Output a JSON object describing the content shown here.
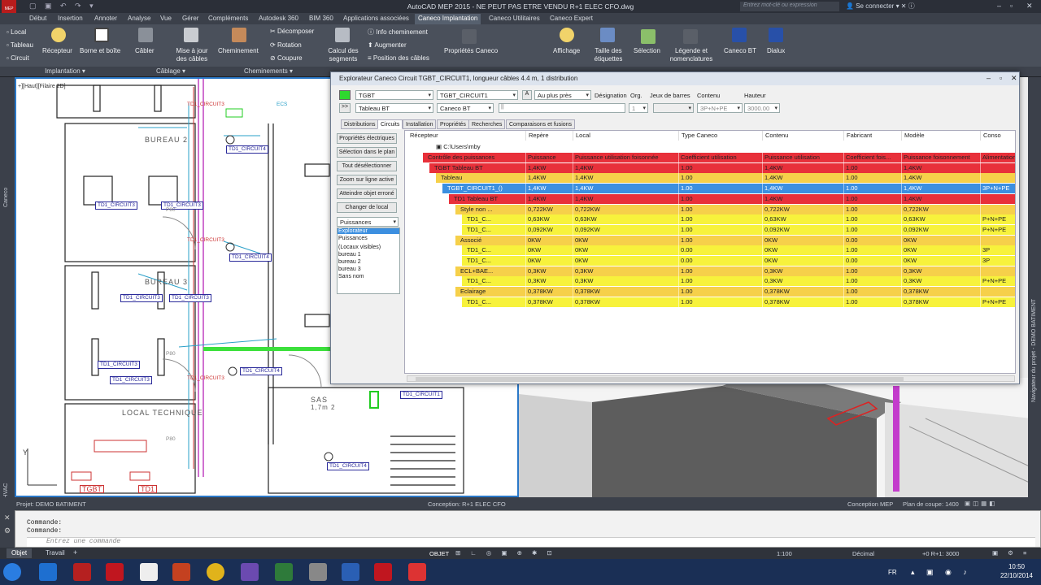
{
  "window": {
    "title": "AutoCAD MEP 2015 - NE PEUT PAS ETRE VENDU    R+1 ELEC CFO.dwg",
    "search_placeholder": "Entrez mot-clé ou expression",
    "signin": "Se connecter",
    "app_badge": "MEP"
  },
  "tabs": [
    "Début",
    "Insertion",
    "Annoter",
    "Analyse",
    "Vue",
    "Gérer",
    "Compléments",
    "Autodesk 360",
    "BIM 360",
    "Applications associées",
    "Caneco Implantation",
    "Caneco Utilitaires",
    "Caneco Expert"
  ],
  "ribbon": {
    "small": [
      "Local",
      "Tableau",
      "Circuit"
    ],
    "buttons": [
      "Récepteur",
      "Borne et boîte",
      "Câbler",
      "Mise à jour des câbles",
      "Cheminement",
      "Décomposer",
      "Rotation",
      "Coupure",
      "Calcul des segments",
      "Info cheminement",
      "Augmenter",
      "Position des câbles",
      "Propriétés Caneco",
      "Affichage",
      "Taille des étiquettes",
      "Sélection",
      "Légende et nomenclatures",
      "Caneco BT",
      "Dialux"
    ],
    "panels": [
      "Implantation",
      "Câblage",
      "Cheminements"
    ]
  },
  "drawing": {
    "viewport_label": "+][Haut][Filaire 2D]",
    "rooms": [
      "BUREAU 2",
      "BUREAU 3",
      "LOCAL TECHNIQUE",
      "SAS",
      "1,7m 2"
    ],
    "tags": [
      "TD1_CIRCUIT4",
      "TD1_CIRCUIT3",
      "TD1_CIRCUIT1",
      "TGBT",
      "TD1",
      "P80",
      "ECS"
    ],
    "axis": "Y",
    "side_left": "Palette d'outils - HVAC",
    "side_left2": "Caneco",
    "side_right": "Navigateur du projet - DEMO BATIMENT"
  },
  "dialog": {
    "title": "Explorateur Caneco  Circuit TGBT_CIRCUIT1, longueur câbles 4.4 m, 1 distribution",
    "row1": {
      "dd1": "TGBT",
      "dd2": "TGBT_CIRCUIT1",
      "a": "A",
      "dd3": "Au plus près",
      "designation": "Désignation",
      "org": "Org.",
      "jeux": "Jeux de barres",
      "contenu": "Contenu",
      "hauteur": "Hauteur"
    },
    "row2": {
      "nav": ">>",
      "dd1": "Tableau BT",
      "dd2": "Caneco BT",
      "field": "||",
      "org_val": "1",
      "contenu_val": "3P+N+PE",
      "hauteur_val": "3000.00"
    },
    "tabs": [
      "Distributions",
      "Circuits",
      "Installation",
      "Propriétés",
      "Recherches",
      "Comparaisons et fusions"
    ],
    "buttons": [
      "Propriétés électriques",
      "Sélection dans le plan",
      "Tout désélectionner",
      "Zoom sur ligne active",
      "Atteindre objet erroné",
      "Changer de local"
    ],
    "combo": "Puissances",
    "list": [
      "Explorateur",
      "Puissances",
      "(Locaux visibles)",
      "bureau 1",
      "bureau 2",
      "bureau 3",
      "Sans nom"
    ],
    "grid": {
      "columns": [
        "Récepteur",
        "Repère",
        "Local",
        "Type Caneco",
        "Contenu",
        "Fabricant",
        "Modèle",
        "Conso"
      ],
      "path": "C:\\Users\\mby",
      "rows": [
        {
          "label": "Contrôle des puissances",
          "c": [
            "Puissance",
            "Puissance utilisation foisonnée",
            "Coefficient utilisation",
            "Puissance utilisation",
            "Coefficient fois...",
            "Puissance foisonnement",
            "Alimentation"
          ],
          "color": "#e8303a",
          "indent": 1
        },
        {
          "label": "TGBT Tableau BT",
          "c": [
            "1,4KW",
            "1,4KW",
            "1.00",
            "1,4KW",
            "1.00",
            "1,4KW",
            ""
          ],
          "color": "#e8303a",
          "indent": 2
        },
        {
          "label": "Tableau",
          "c": [
            "1,4KW",
            "1,4KW",
            "1.00",
            "1,4KW",
            "1.00",
            "1,4KW",
            ""
          ],
          "color": "#f6d04a",
          "indent": 3
        },
        {
          "label": "TGBT_CIRCUIT1_()",
          "c": [
            "1,4KW",
            "1,4KW",
            "1.00",
            "1,4KW",
            "1.00",
            "1,4KW",
            "3P+N+PE"
          ],
          "color": "#3c8fe0",
          "indent": 4
        },
        {
          "label": "TD1 Tableau BT",
          "c": [
            "1,4KW",
            "1,4KW",
            "1.00",
            "1,4KW",
            "1.00",
            "1,4KW",
            ""
          ],
          "color": "#e8303a",
          "indent": 5
        },
        {
          "label": "Style non ...",
          "c": [
            "0,722KW",
            "0,722KW",
            "1.00",
            "0,722KW",
            "1.00",
            "0,722KW",
            ""
          ],
          "color": "#f6d04a",
          "indent": 6
        },
        {
          "label": "TD1_C...",
          "c": [
            "0,63KW",
            "0,63KW",
            "1.00",
            "0,63KW",
            "1.00",
            "0,63KW",
            "P+N+PE"
          ],
          "color": "#f7f23c",
          "indent": 7
        },
        {
          "label": "TD1_C...",
          "c": [
            "0,092KW",
            "0,092KW",
            "1.00",
            "0,092KW",
            "1.00",
            "0,092KW",
            "P+N+PE"
          ],
          "color": "#f7f23c",
          "indent": 7
        },
        {
          "label": "Associé",
          "c": [
            "0KW",
            "0KW",
            "1.00",
            "0KW",
            "0.00",
            "0KW",
            ""
          ],
          "color": "#f6d04a",
          "indent": 6
        },
        {
          "label": "TD1_C...",
          "c": [
            "0KW",
            "0KW",
            "0.00",
            "0KW",
            "1.00",
            "0KW",
            "3P"
          ],
          "color": "#f7f23c",
          "indent": 7
        },
        {
          "label": "TD1_C...",
          "c": [
            "0KW",
            "0KW",
            "0.00",
            "0KW",
            "0.00",
            "0KW",
            "3P"
          ],
          "color": "#f7f23c",
          "indent": 7
        },
        {
          "label": "ECL+BAE...",
          "c": [
            "0,3KW",
            "0,3KW",
            "1.00",
            "0,3KW",
            "1.00",
            "0,3KW",
            ""
          ],
          "color": "#f6d04a",
          "indent": 6
        },
        {
          "label": "TD1_C...",
          "c": [
            "0,3KW",
            "0,3KW",
            "1.00",
            "0,3KW",
            "1.00",
            "0,3KW",
            "P+N+PE"
          ],
          "color": "#f7f23c",
          "indent": 7
        },
        {
          "label": "Eclairage",
          "c": [
            "0,378KW",
            "0,378KW",
            "1.00",
            "0,378KW",
            "1.00",
            "0,378KW",
            ""
          ],
          "color": "#f6d04a",
          "indent": 6
        },
        {
          "label": "TD1_C...",
          "c": [
            "0,378KW",
            "0,378KW",
            "1.00",
            "0,378KW",
            "1.00",
            "0,378KW",
            "P+N+PE"
          ],
          "color": "#f7f23c",
          "indent": 7
        }
      ]
    }
  },
  "status": {
    "project": "Projet: DEMO BATIMENT",
    "conception": "Conception: R+1 ELEC CFO",
    "mode": "Conception MEP",
    "plan": "Plan de coupe: 1400",
    "objet": "OBJET",
    "scale": "1:100",
    "decimal": "Décimal",
    "level": "+0 R+1: 3000"
  },
  "command": {
    "line1": "Commande:",
    "line2": "Commande:",
    "placeholder": "Entrez une commande"
  },
  "layouts": [
    "Objet",
    "Travail"
  ],
  "taskbar": {
    "lang": "FR",
    "time": "10:50",
    "date": "22/10/2014"
  }
}
